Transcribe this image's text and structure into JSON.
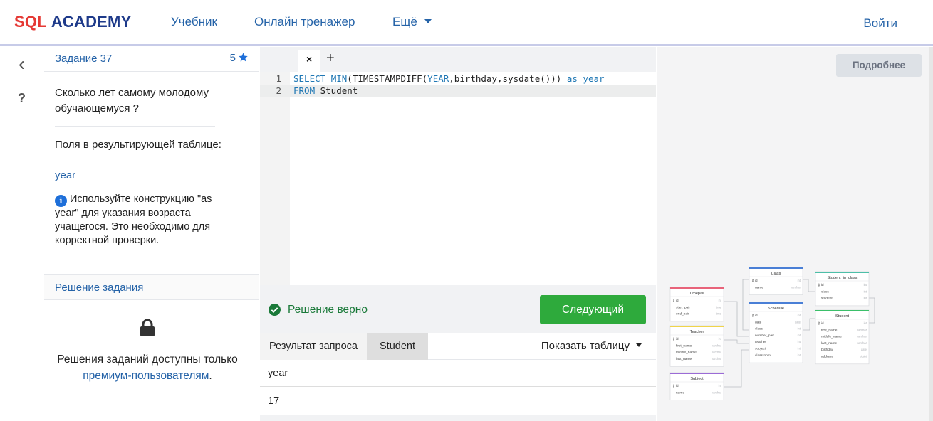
{
  "header": {
    "logo_sql": "SQL",
    "logo_academy": "ACADEMY",
    "nav": [
      "Учебник",
      "Онлайн тренажер",
      "Ещё"
    ],
    "login": "Войти",
    "accent": "#2563a8",
    "logo_red": "#e53935"
  },
  "rail": {
    "back_icon": "chevron-left-icon",
    "help_icon": "question-icon",
    "back_glyph": "‹",
    "help_glyph": "?"
  },
  "task": {
    "title": "Задание 37",
    "score": "5",
    "question": "Сколько лет самому молодому обучающемуся ?",
    "fields_label": "Поля в результирующей таблице:",
    "fields_value": "year",
    "hint": "Используйте конструкцию \"as year\" для указания возраста учащегося. Это необходимо для корректной проверки.",
    "solution_title": "Решение задания",
    "premium_text": "Решения заданий доступны только",
    "premium_link": "премиум-пользователям",
    "premium_dot": "."
  },
  "editor": {
    "tab_close": "×",
    "tab_add": "+",
    "line_numbers": [
      "1",
      "2"
    ],
    "line1": {
      "p1": "SELECT",
      "p2": " ",
      "p3": "MIN",
      "p4": "(",
      "p5": "TIMESTAMPDIFF",
      "p6": "(",
      "p7": "YEAR",
      "p8": ",birthday,sysdate()",
      "p9": "))",
      "p10": " ",
      "p11": "as",
      "p12": " ",
      "p13": "year"
    },
    "line2": {
      "p1": "FROM",
      "p2": " Student"
    }
  },
  "result": {
    "status": "Решение верно",
    "next_button": "Следующий",
    "success_color": "#2eaa3c",
    "tab_query": "Результат запроса",
    "tab_student": "Student",
    "show_table": "Показать таблицу",
    "column": "year",
    "value": "17"
  },
  "schema": {
    "more_button": "Подробнее",
    "tables": {
      "timepair": {
        "title": "Timepair",
        "fields": [
          "id",
          "start_pair",
          "end_pair"
        ],
        "types": [
          "int",
          "time",
          "time"
        ]
      },
      "teacher": {
        "title": "Teacher",
        "fields": [
          "id",
          "first_name",
          "middle_name",
          "last_name"
        ],
        "types": [
          "int",
          "varchar",
          "varchar",
          "varchar"
        ]
      },
      "subject": {
        "title": "Subject",
        "fields": [
          "id",
          "name"
        ],
        "types": [
          "int",
          "varchar"
        ]
      },
      "class": {
        "title": "Class",
        "fields": [
          "id",
          "name"
        ],
        "types": [
          "int",
          "varchar"
        ]
      },
      "schedule": {
        "title": "Schedule",
        "fields": [
          "id",
          "date",
          "class",
          "number_pair",
          "teacher",
          "subject",
          "classroom"
        ],
        "types": [
          "int",
          "date",
          "int",
          "int",
          "int",
          "int",
          "int"
        ]
      },
      "student_in_class": {
        "title": "Student_in_class",
        "fields": [
          "id",
          "class",
          "student"
        ],
        "types": [
          "int",
          "int",
          "int"
        ]
      },
      "student": {
        "title": "Student",
        "fields": [
          "id",
          "first_name",
          "middle_name",
          "last_name",
          "birthday",
          "address"
        ],
        "types": [
          "int",
          "varchar",
          "varchar",
          "varchar",
          "date",
          "bigint"
        ]
      }
    }
  }
}
